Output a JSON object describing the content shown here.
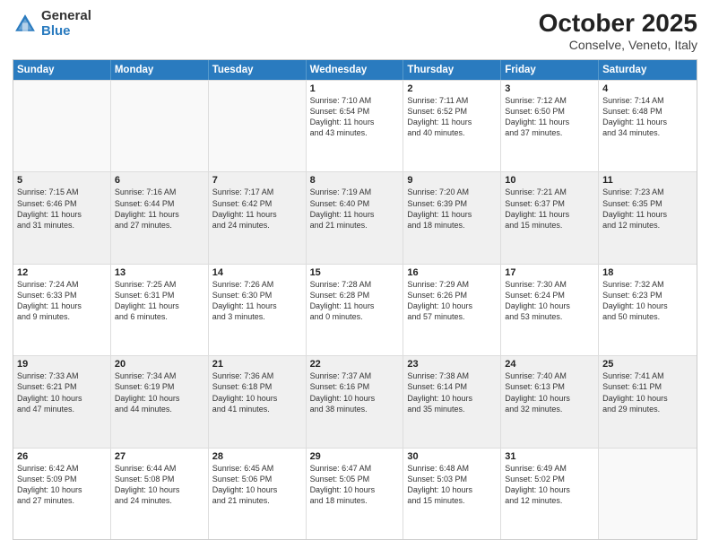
{
  "header": {
    "logo_general": "General",
    "logo_blue": "Blue",
    "month_title": "October 2025",
    "location": "Conselve, Veneto, Italy"
  },
  "weekdays": [
    "Sunday",
    "Monday",
    "Tuesday",
    "Wednesday",
    "Thursday",
    "Friday",
    "Saturday"
  ],
  "rows": [
    [
      {
        "day": "",
        "lines": [],
        "empty": true
      },
      {
        "day": "",
        "lines": [],
        "empty": true
      },
      {
        "day": "",
        "lines": [],
        "empty": true
      },
      {
        "day": "1",
        "lines": [
          "Sunrise: 7:10 AM",
          "Sunset: 6:54 PM",
          "Daylight: 11 hours",
          "and 43 minutes."
        ]
      },
      {
        "day": "2",
        "lines": [
          "Sunrise: 7:11 AM",
          "Sunset: 6:52 PM",
          "Daylight: 11 hours",
          "and 40 minutes."
        ]
      },
      {
        "day": "3",
        "lines": [
          "Sunrise: 7:12 AM",
          "Sunset: 6:50 PM",
          "Daylight: 11 hours",
          "and 37 minutes."
        ]
      },
      {
        "day": "4",
        "lines": [
          "Sunrise: 7:14 AM",
          "Sunset: 6:48 PM",
          "Daylight: 11 hours",
          "and 34 minutes."
        ]
      }
    ],
    [
      {
        "day": "5",
        "lines": [
          "Sunrise: 7:15 AM",
          "Sunset: 6:46 PM",
          "Daylight: 11 hours",
          "and 31 minutes."
        ],
        "shaded": true
      },
      {
        "day": "6",
        "lines": [
          "Sunrise: 7:16 AM",
          "Sunset: 6:44 PM",
          "Daylight: 11 hours",
          "and 27 minutes."
        ],
        "shaded": true
      },
      {
        "day": "7",
        "lines": [
          "Sunrise: 7:17 AM",
          "Sunset: 6:42 PM",
          "Daylight: 11 hours",
          "and 24 minutes."
        ],
        "shaded": true
      },
      {
        "day": "8",
        "lines": [
          "Sunrise: 7:19 AM",
          "Sunset: 6:40 PM",
          "Daylight: 11 hours",
          "and 21 minutes."
        ],
        "shaded": true
      },
      {
        "day": "9",
        "lines": [
          "Sunrise: 7:20 AM",
          "Sunset: 6:39 PM",
          "Daylight: 11 hours",
          "and 18 minutes."
        ],
        "shaded": true
      },
      {
        "day": "10",
        "lines": [
          "Sunrise: 7:21 AM",
          "Sunset: 6:37 PM",
          "Daylight: 11 hours",
          "and 15 minutes."
        ],
        "shaded": true
      },
      {
        "day": "11",
        "lines": [
          "Sunrise: 7:23 AM",
          "Sunset: 6:35 PM",
          "Daylight: 11 hours",
          "and 12 minutes."
        ],
        "shaded": true
      }
    ],
    [
      {
        "day": "12",
        "lines": [
          "Sunrise: 7:24 AM",
          "Sunset: 6:33 PM",
          "Daylight: 11 hours",
          "and 9 minutes."
        ]
      },
      {
        "day": "13",
        "lines": [
          "Sunrise: 7:25 AM",
          "Sunset: 6:31 PM",
          "Daylight: 11 hours",
          "and 6 minutes."
        ]
      },
      {
        "day": "14",
        "lines": [
          "Sunrise: 7:26 AM",
          "Sunset: 6:30 PM",
          "Daylight: 11 hours",
          "and 3 minutes."
        ]
      },
      {
        "day": "15",
        "lines": [
          "Sunrise: 7:28 AM",
          "Sunset: 6:28 PM",
          "Daylight: 11 hours",
          "and 0 minutes."
        ]
      },
      {
        "day": "16",
        "lines": [
          "Sunrise: 7:29 AM",
          "Sunset: 6:26 PM",
          "Daylight: 10 hours",
          "and 57 minutes."
        ]
      },
      {
        "day": "17",
        "lines": [
          "Sunrise: 7:30 AM",
          "Sunset: 6:24 PM",
          "Daylight: 10 hours",
          "and 53 minutes."
        ]
      },
      {
        "day": "18",
        "lines": [
          "Sunrise: 7:32 AM",
          "Sunset: 6:23 PM",
          "Daylight: 10 hours",
          "and 50 minutes."
        ]
      }
    ],
    [
      {
        "day": "19",
        "lines": [
          "Sunrise: 7:33 AM",
          "Sunset: 6:21 PM",
          "Daylight: 10 hours",
          "and 47 minutes."
        ],
        "shaded": true
      },
      {
        "day": "20",
        "lines": [
          "Sunrise: 7:34 AM",
          "Sunset: 6:19 PM",
          "Daylight: 10 hours",
          "and 44 minutes."
        ],
        "shaded": true
      },
      {
        "day": "21",
        "lines": [
          "Sunrise: 7:36 AM",
          "Sunset: 6:18 PM",
          "Daylight: 10 hours",
          "and 41 minutes."
        ],
        "shaded": true
      },
      {
        "day": "22",
        "lines": [
          "Sunrise: 7:37 AM",
          "Sunset: 6:16 PM",
          "Daylight: 10 hours",
          "and 38 minutes."
        ],
        "shaded": true
      },
      {
        "day": "23",
        "lines": [
          "Sunrise: 7:38 AM",
          "Sunset: 6:14 PM",
          "Daylight: 10 hours",
          "and 35 minutes."
        ],
        "shaded": true
      },
      {
        "day": "24",
        "lines": [
          "Sunrise: 7:40 AM",
          "Sunset: 6:13 PM",
          "Daylight: 10 hours",
          "and 32 minutes."
        ],
        "shaded": true
      },
      {
        "day": "25",
        "lines": [
          "Sunrise: 7:41 AM",
          "Sunset: 6:11 PM",
          "Daylight: 10 hours",
          "and 29 minutes."
        ],
        "shaded": true
      }
    ],
    [
      {
        "day": "26",
        "lines": [
          "Sunrise: 6:42 AM",
          "Sunset: 5:09 PM",
          "Daylight: 10 hours",
          "and 27 minutes."
        ]
      },
      {
        "day": "27",
        "lines": [
          "Sunrise: 6:44 AM",
          "Sunset: 5:08 PM",
          "Daylight: 10 hours",
          "and 24 minutes."
        ]
      },
      {
        "day": "28",
        "lines": [
          "Sunrise: 6:45 AM",
          "Sunset: 5:06 PM",
          "Daylight: 10 hours",
          "and 21 minutes."
        ]
      },
      {
        "day": "29",
        "lines": [
          "Sunrise: 6:47 AM",
          "Sunset: 5:05 PM",
          "Daylight: 10 hours",
          "and 18 minutes."
        ]
      },
      {
        "day": "30",
        "lines": [
          "Sunrise: 6:48 AM",
          "Sunset: 5:03 PM",
          "Daylight: 10 hours",
          "and 15 minutes."
        ]
      },
      {
        "day": "31",
        "lines": [
          "Sunrise: 6:49 AM",
          "Sunset: 5:02 PM",
          "Daylight: 10 hours",
          "and 12 minutes."
        ]
      },
      {
        "day": "",
        "lines": [],
        "empty": true
      }
    ]
  ]
}
